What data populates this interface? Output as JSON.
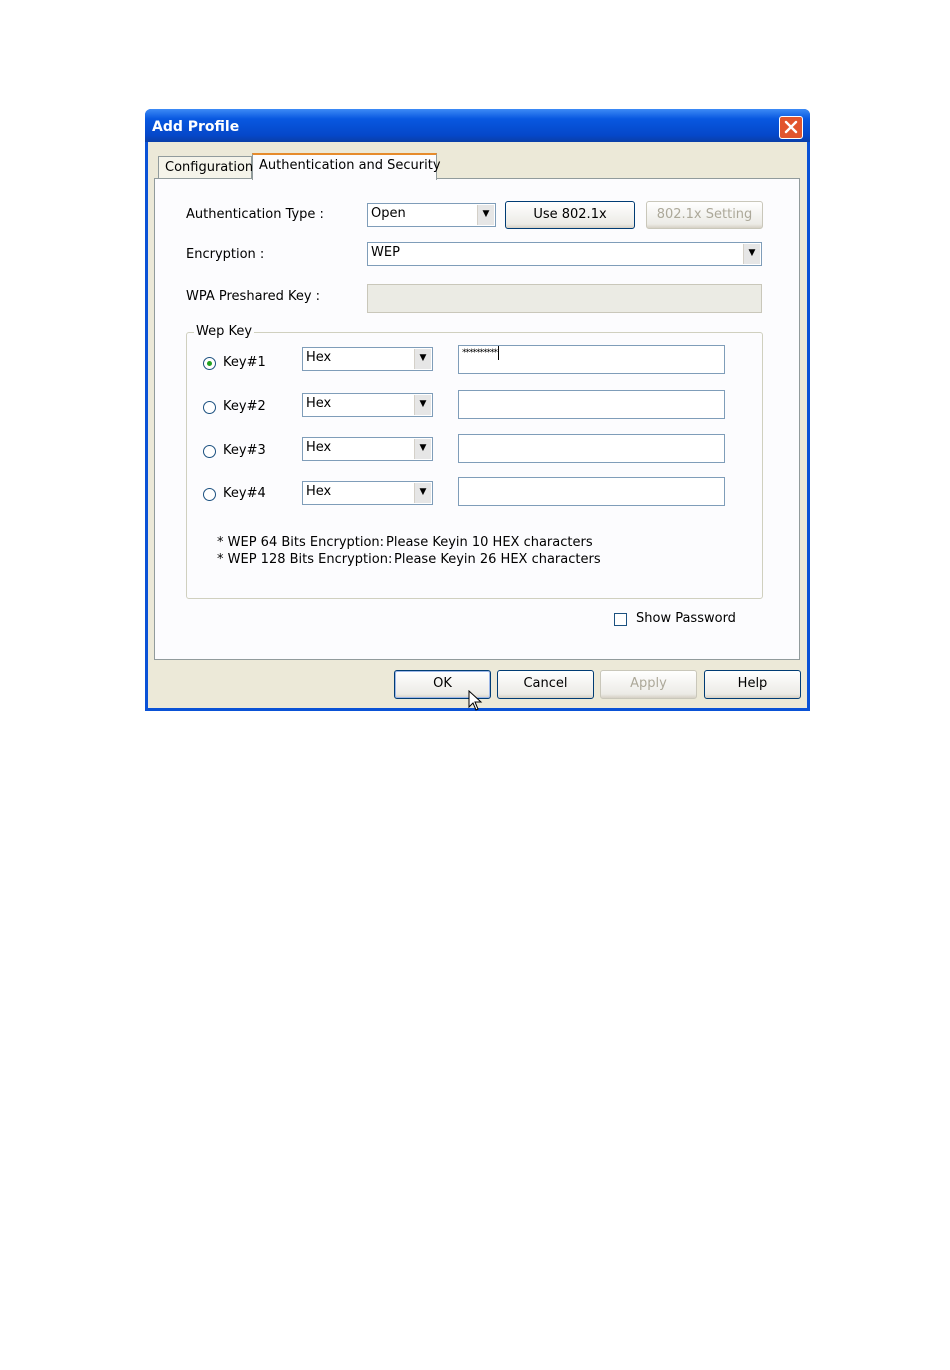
{
  "window": {
    "title": "Add Profile",
    "close_icon": "close-icon"
  },
  "tabs": [
    {
      "label": "Configuration"
    },
    {
      "label": "Authentication and Security"
    }
  ],
  "auth": {
    "type_label": "Authentication Type :",
    "type_value": "Open",
    "use8021x_label": "Use 802.1x",
    "setting8021x_label": "802.1x Setting"
  },
  "encryption": {
    "label": "Encryption :",
    "value": "WEP"
  },
  "wpa": {
    "label": "WPA Preshared Key :",
    "value": ""
  },
  "wep": {
    "caption": "Wep Key",
    "keys": [
      {
        "label": "Key#1",
        "format": "Hex",
        "value": "**********",
        "selected": true
      },
      {
        "label": "Key#2",
        "format": "Hex",
        "value": "",
        "selected": false
      },
      {
        "label": "Key#3",
        "format": "Hex",
        "value": "",
        "selected": false
      },
      {
        "label": "Key#4",
        "format": "Hex",
        "value": "",
        "selected": false
      }
    ],
    "note1_a": "* WEP 64 Bits Encryption:",
    "note1_b": "Please Keyin 10 HEX characters",
    "note2_a": "* WEP 128 Bits Encryption:",
    "note2_b": "Please Keyin 26 HEX characters"
  },
  "show_password": {
    "label": "Show Password",
    "checked": false
  },
  "buttons": {
    "ok": "OK",
    "cancel": "Cancel",
    "apply": "Apply",
    "help": "Help"
  },
  "colors": {
    "titlebar": "#0a52d6",
    "dialog": "#ece9d8",
    "close": "#e2552e"
  }
}
